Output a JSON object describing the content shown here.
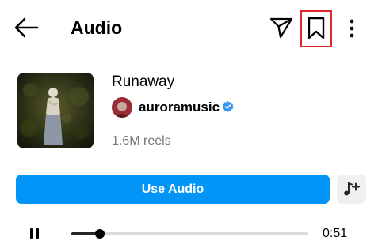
{
  "header": {
    "title": "Audio",
    "icons": {
      "back": "arrow-left-icon",
      "share": "send-icon",
      "save": "bookmark-icon",
      "more": "more-vertical-icon"
    }
  },
  "audio": {
    "title": "Runaway",
    "artist": "auroramusic",
    "verified": true,
    "reels_count": "1.6M reels"
  },
  "actions": {
    "use_audio_label": "Use Audio",
    "add_icon": "music-add-icon"
  },
  "player": {
    "state": "playing",
    "progress": 0.12,
    "duration": "0:51"
  },
  "colors": {
    "accent": "#0095f6",
    "verified": "#3897f0",
    "highlight": "#e0262d"
  }
}
